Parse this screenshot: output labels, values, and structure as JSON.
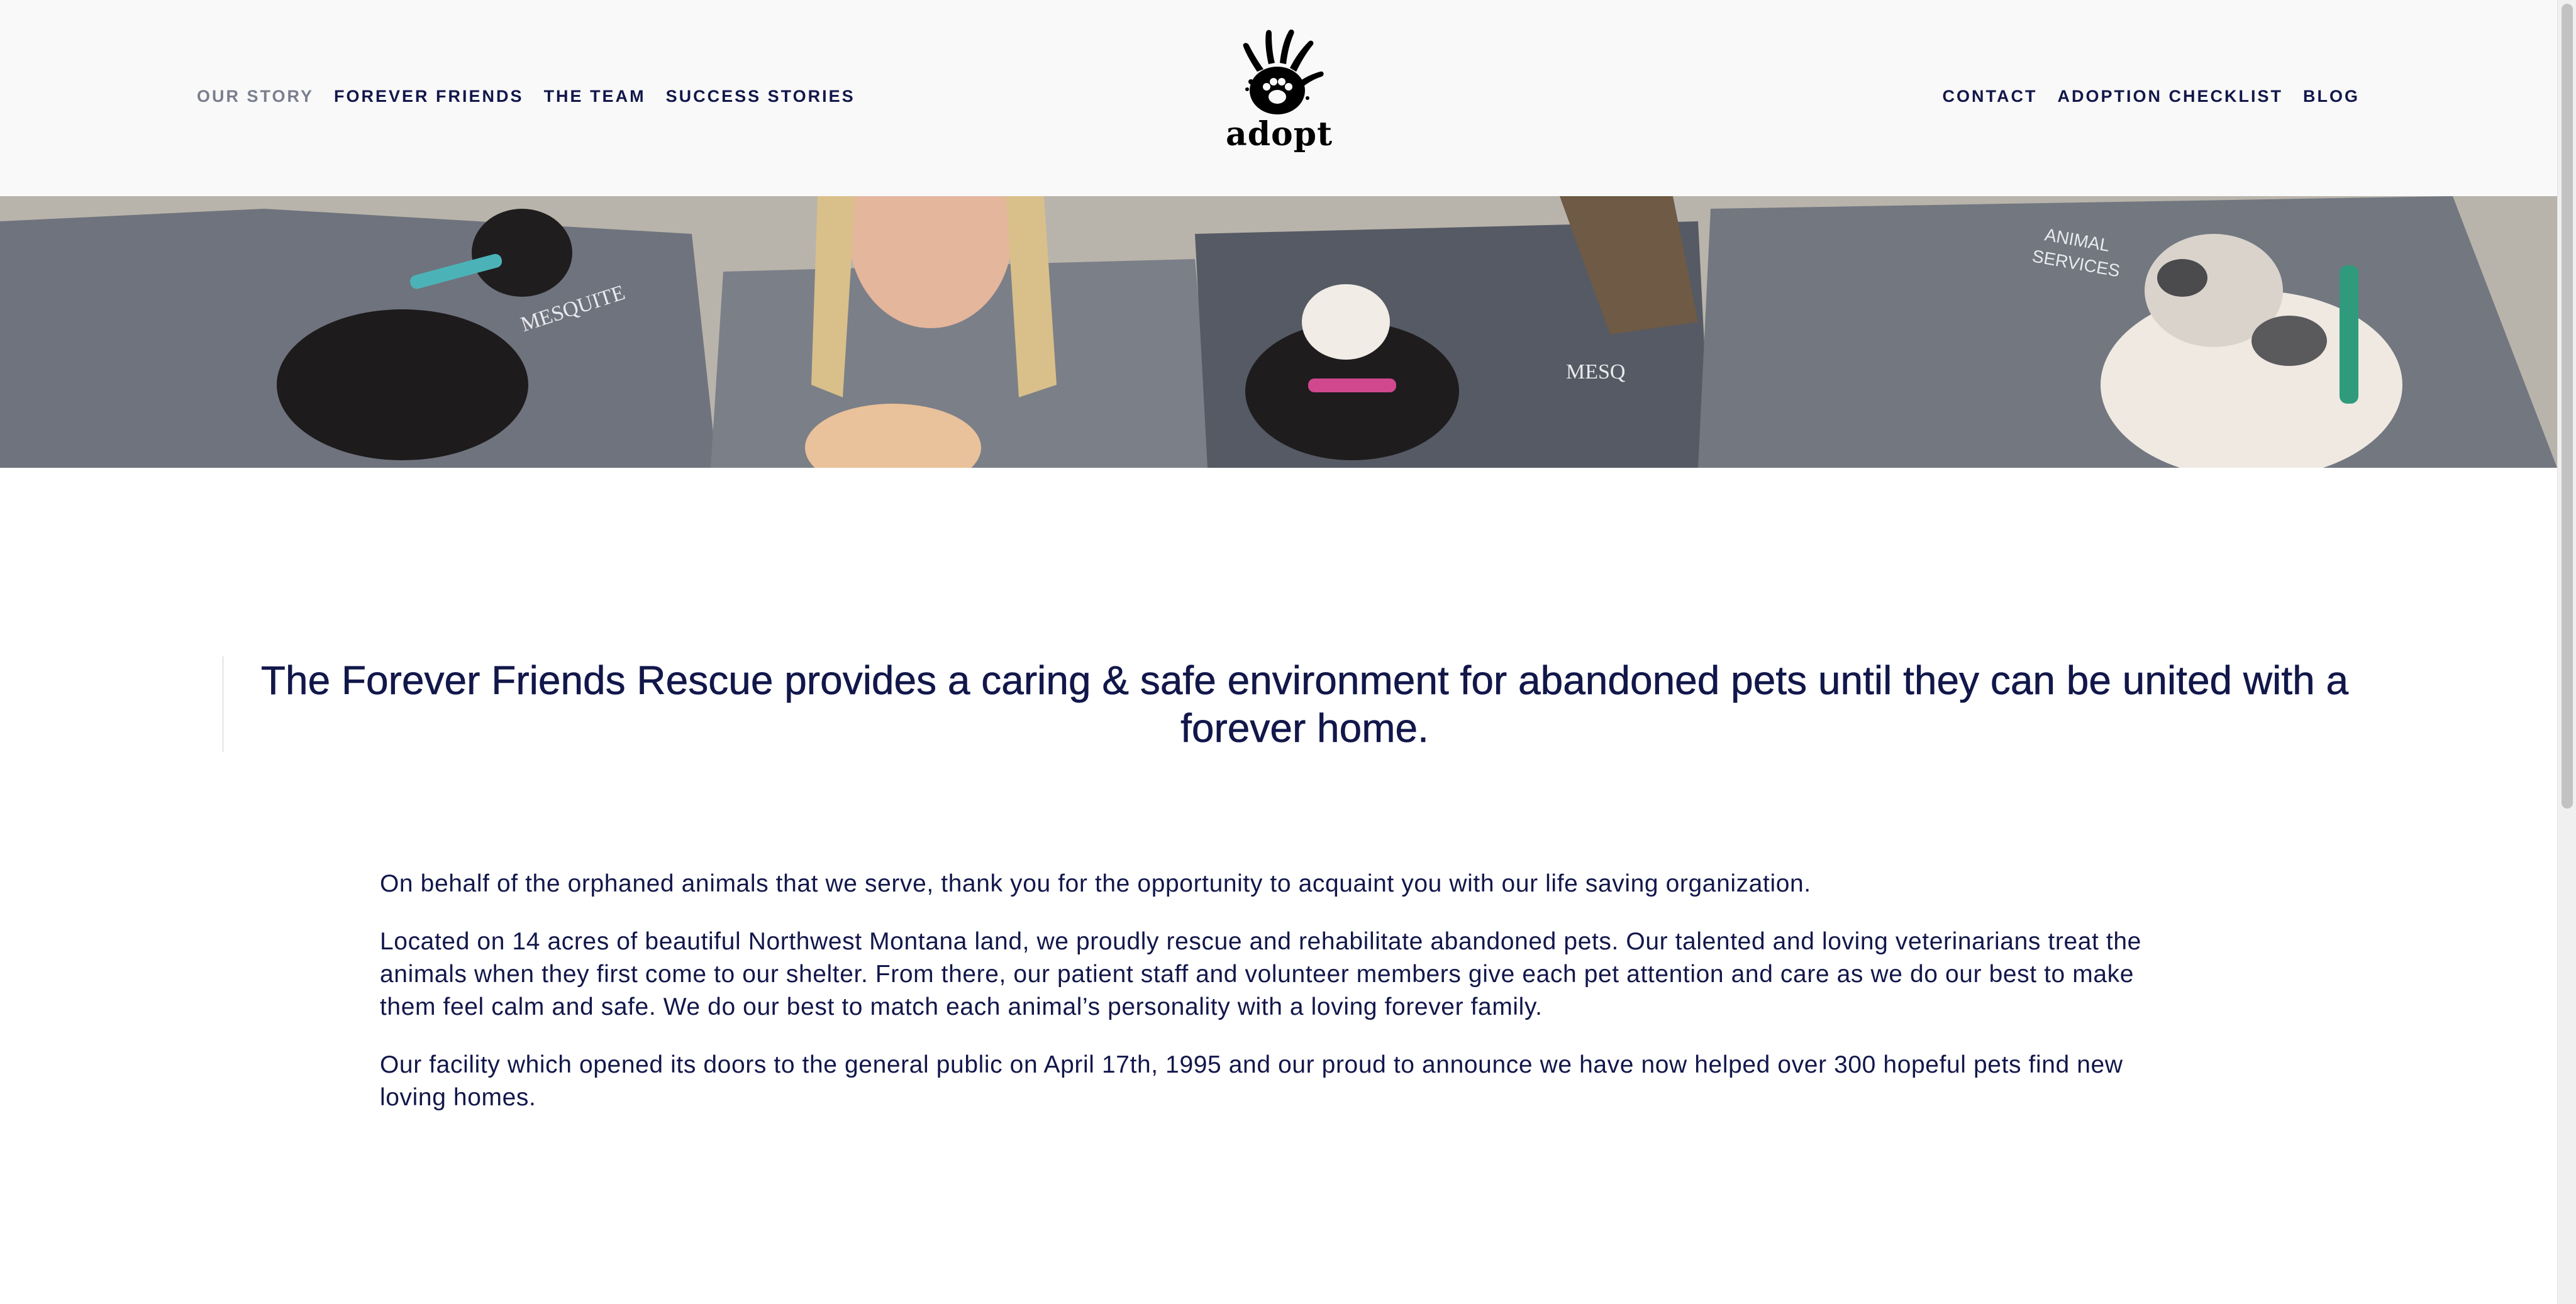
{
  "header": {
    "nav_left": [
      {
        "label": "OUR STORY",
        "active": true
      },
      {
        "label": "FOREVER FRIENDS",
        "active": false
      },
      {
        "label": "THE TEAM",
        "active": false
      },
      {
        "label": "SUCCESS STORIES",
        "active": false
      }
    ],
    "logo_text": "adopt",
    "nav_right": [
      {
        "label": "CONTACT"
      },
      {
        "label": "ADOPTION CHECKLIST"
      },
      {
        "label": "BLOG"
      }
    ]
  },
  "banner": {
    "icon": "photo-of-shelter-staff-with-pets"
  },
  "main": {
    "quote": "The Forever Friends Rescue provides a caring & safe environment for abandoned pets until they can be united with a forever home.",
    "paragraphs": [
      "On behalf of the orphaned animals that we serve, thank you for the opportunity to acquaint you with our life saving organization.",
      "Located on 14 acres of beautiful Northwest Montana land, we proudly rescue and rehabilitate abandoned pets. Our talented and loving veterinarians treat the animals when they first come to our shelter. From there, our patient staff and volunteer members give each pet attention and care as we do our best to make them feel calm and safe. We do our best to match each animal’s personality with a loving forever family.",
      "Our facility which opened its doors to the general public on April 17th, 1995 and our proud to announce we have now helped over 300 hopeful pets find new loving homes."
    ]
  },
  "colors": {
    "text": "#12174a",
    "header_bg": "#f9f9f9",
    "active_nav": "#7a7e8e"
  }
}
